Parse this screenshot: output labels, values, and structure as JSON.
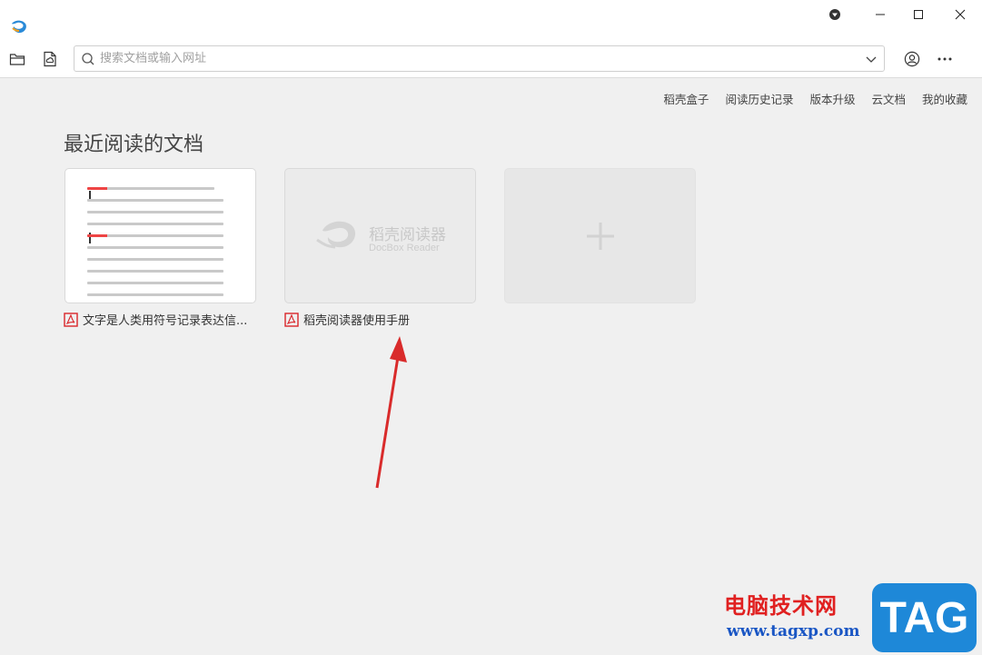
{
  "titlebar": {
    "icons": [
      "app-logo-icon",
      "dropdown-icon",
      "minimize-icon",
      "maximize-icon",
      "close-icon"
    ]
  },
  "toolbar": {
    "search_placeholder": "搜索文档或输入网址",
    "icons": [
      "folder-icon",
      "cloud-doc-icon",
      "search-icon",
      "chevron-down-icon",
      "user-icon",
      "more-icon"
    ]
  },
  "nav": {
    "links": [
      "稻壳盒子",
      "阅读历史记录",
      "版本升级",
      "云文档",
      "我的收藏"
    ]
  },
  "recent": {
    "title": "最近阅读的文档",
    "docs": [
      {
        "name": "文字是人类用符号记录表达信...",
        "type": "pdf"
      },
      {
        "name": "稻壳阅读器使用手册",
        "type": "pdf",
        "logo_text": "稻壳阅读器",
        "logo_sub": "DocBox Reader"
      }
    ],
    "add_icon": "plus-icon"
  },
  "watermark": {
    "cn": "电脑技术网",
    "url": "www.tagxp.com",
    "tag": "TAG"
  },
  "colors": {
    "accent_red": "#d9252a",
    "pdf_red": "#d9252a",
    "link": "#444444",
    "arrow": "#d92b2b"
  }
}
